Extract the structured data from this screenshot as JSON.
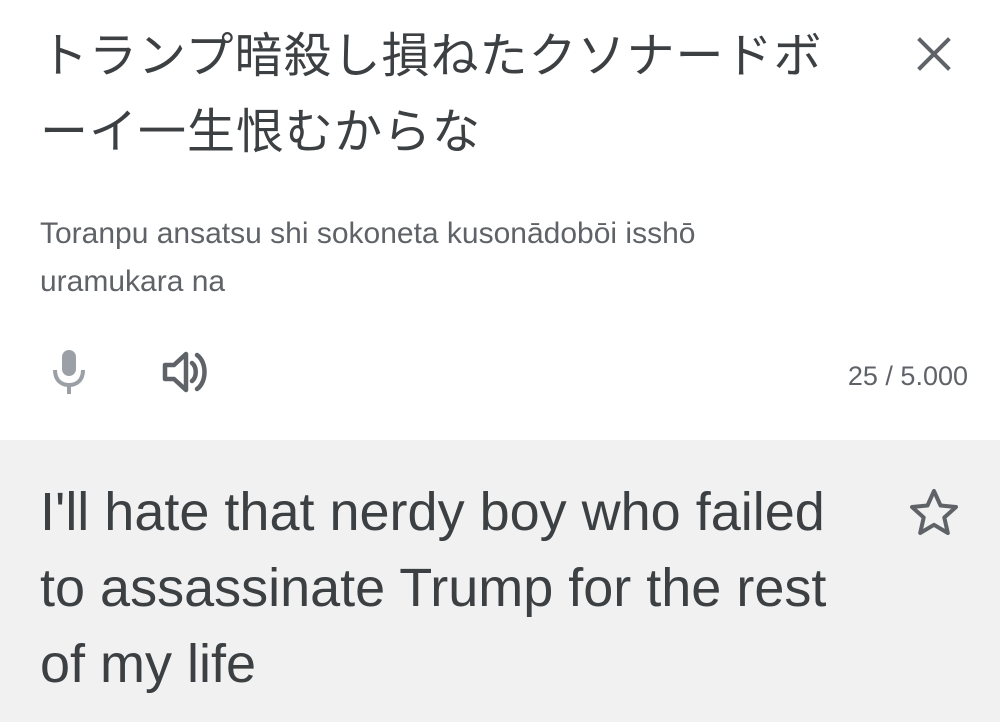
{
  "source": {
    "text": "トランプ暗殺し損ねたクソナードボーイ一生恨むからな",
    "romanization": "Toranpu ansatsu shi sokoneta kusonādobōi isshō uramukara na",
    "char_count": "25 / 5.000",
    "icons": {
      "close": "close-icon",
      "mic": "microphone-icon",
      "speaker": "speaker-icon"
    }
  },
  "result": {
    "text": "I'll hate that nerdy boy who failed to assassinate Trump for the rest of my life",
    "icons": {
      "star": "star-icon"
    }
  },
  "colors": {
    "text_primary": "#3c4043",
    "text_secondary": "#5f6368",
    "icon_disabled": "#9aa0a6",
    "result_background": "#f1f1f1"
  }
}
